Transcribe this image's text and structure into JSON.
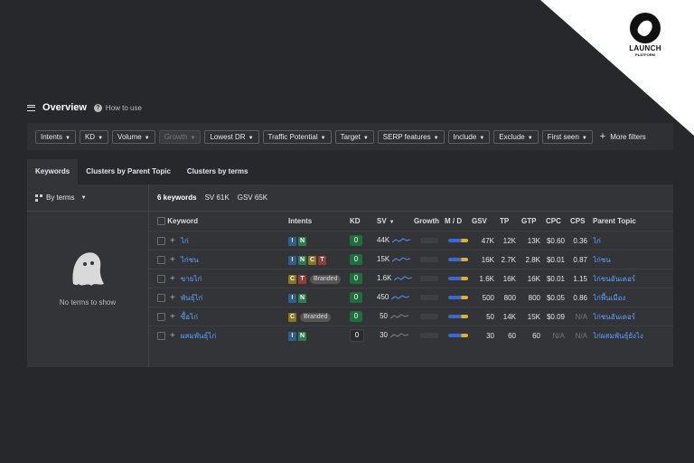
{
  "brand": {
    "line1": "LAUNCH",
    "line2": "PLATFORM"
  },
  "header": {
    "title": "Overview",
    "how_to": "How to use"
  },
  "filters": [
    "Intents",
    "KD",
    "Volume",
    "Growth",
    "Lowest DR",
    "Traffic Potential",
    "Target",
    "SERP features",
    "Include",
    "Exclude",
    "First seen"
  ],
  "disabled_filter": "Growth",
  "more_filters": "More filters",
  "tabs": [
    "Keywords",
    "Clusters by Parent Topic",
    "Clusters by terms"
  ],
  "left_panel": {
    "by_terms": "By terms",
    "empty": "No terms to show"
  },
  "summary": {
    "count": "6 keywords",
    "sv": "SV 61K",
    "gsv": "GSV 65K"
  },
  "columns": [
    "Keyword",
    "Intents",
    "KD",
    "SV",
    "Growth",
    "M / D",
    "GSV",
    "TP",
    "GTP",
    "CPC",
    "CPS",
    "Parent Topic"
  ],
  "rows": [
    {
      "keyword": "ไก่",
      "intents": [
        "I",
        "N"
      ],
      "branded": "",
      "kd": "0",
      "sv": "44K",
      "gsv": "47K",
      "tp": "12K",
      "gtp": "13K",
      "cpc": "$0.60",
      "cps": "0.36",
      "parent": "ไก่"
    },
    {
      "keyword": "ไก่ชน",
      "intents": [
        "I",
        "N",
        "C",
        "T"
      ],
      "branded": "",
      "kd": "0",
      "sv": "15K",
      "gsv": "16K",
      "tp": "2.7K",
      "gtp": "2.8K",
      "cpc": "$0.01",
      "cps": "0.87",
      "parent": "ไก่ชน"
    },
    {
      "keyword": "ขายไก่",
      "intents": [
        "C",
        "T"
      ],
      "branded": "Branded",
      "kd": "0",
      "sv": "1.6K",
      "gsv": "1.6K",
      "tp": "16K",
      "gtp": "16K",
      "cpc": "$0.01",
      "cps": "1.15",
      "parent": "ไก่ชนอันเดอร์"
    },
    {
      "keyword": "พันธุ์ไก่",
      "intents": [
        "I",
        "N"
      ],
      "branded": "",
      "kd": "0",
      "sv": "450",
      "gsv": "500",
      "tp": "800",
      "gtp": "800",
      "cpc": "$0.05",
      "cps": "0.86",
      "parent": "ไก่พื้นเมือง"
    },
    {
      "keyword": "ซื้อไก่",
      "intents": [
        "C"
      ],
      "branded": "Branded",
      "kd": "0",
      "sv": "50",
      "gsv": "50",
      "tp": "14K",
      "gtp": "15K",
      "cpc": "$0.09",
      "cps": "N/A",
      "parent": "ไก่ชนอันเดอร์"
    },
    {
      "keyword": "ผสมพันธุ์ไก่",
      "intents": [
        "I",
        "N"
      ],
      "branded": "",
      "kd": "0",
      "sv": "30",
      "gsv": "30",
      "tp": "60",
      "gtp": "60",
      "cpc": "N/A",
      "cps": "N/A",
      "parent": "ไก่ผสมพันธุ์ยังไง"
    }
  ],
  "colors": {
    "background": "#27282b",
    "panel": "#333437",
    "link": "#5aa2ff",
    "kd_easy": "#1f6f3c"
  }
}
